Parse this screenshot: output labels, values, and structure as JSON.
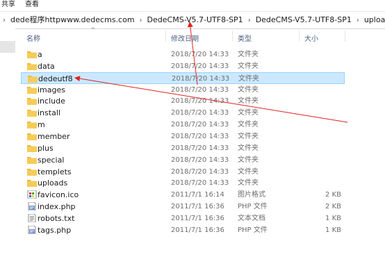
{
  "menu": {
    "share_label": "共享",
    "view_label": "查看"
  },
  "breadcrumb": {
    "items": [
      "dede程序httpwww.dedecms.com",
      "DedeCMS-V5.7-UTF8-SP1",
      "DedeCMS-V5.7-UTF8-SP1",
      "uploads"
    ],
    "separator": "›"
  },
  "columns": {
    "name": "名称",
    "date": "修改日期",
    "type": "类型",
    "size": "大小"
  },
  "files": [
    {
      "name": "a",
      "date": "2018/7/20 14:33",
      "type": "文件夹",
      "size": "",
      "icon": "folder-icon"
    },
    {
      "name": "data",
      "date": "2018/7/20 14:33",
      "type": "文件夹",
      "size": "",
      "icon": "folder-icon"
    },
    {
      "name": "dedeutf8",
      "date": "2018/7/20 14:33",
      "type": "文件夹",
      "size": "",
      "icon": "folder-icon",
      "selected": true
    },
    {
      "name": "images",
      "date": "2018/7/20 14:33",
      "type": "文件夹",
      "size": "",
      "icon": "folder-icon"
    },
    {
      "name": "include",
      "date": "2018/7/20 14:33",
      "type": "文件夹",
      "size": "",
      "icon": "folder-icon"
    },
    {
      "name": "install",
      "date": "2018/7/20 14:33",
      "type": "文件夹",
      "size": "",
      "icon": "folder-icon"
    },
    {
      "name": "m",
      "date": "2018/7/20 14:33",
      "type": "文件夹",
      "size": "",
      "icon": "folder-icon"
    },
    {
      "name": "member",
      "date": "2018/7/20 14:33",
      "type": "文件夹",
      "size": "",
      "icon": "folder-icon"
    },
    {
      "name": "plus",
      "date": "2018/7/20 14:33",
      "type": "文件夹",
      "size": "",
      "icon": "folder-icon"
    },
    {
      "name": "special",
      "date": "2018/7/20 14:33",
      "type": "文件夹",
      "size": "",
      "icon": "folder-icon"
    },
    {
      "name": "templets",
      "date": "2018/7/20 14:33",
      "type": "文件夹",
      "size": "",
      "icon": "folder-icon"
    },
    {
      "name": "uploads",
      "date": "2018/7/20 14:33",
      "type": "文件夹",
      "size": "",
      "icon": "folder-icon"
    },
    {
      "name": "favicon.ico",
      "date": "2011/7/1 16:14",
      "type": "图片格式",
      "size": "2 KB",
      "icon": "image-file-icon"
    },
    {
      "name": "index.php",
      "date": "2011/7/1 16:36",
      "type": "PHP 文件",
      "size": "2 KB",
      "icon": "php-file-icon"
    },
    {
      "name": "robots.txt",
      "date": "2011/7/1 16:36",
      "type": "文本文档",
      "size": "1 KB",
      "icon": "text-file-icon"
    },
    {
      "name": "tags.php",
      "date": "2011/7/1 16:36",
      "type": "PHP 文件",
      "size": "1 KB",
      "icon": "php-file-icon"
    }
  ],
  "colors": {
    "selection_bg": "#cce8ff",
    "selection_border": "#99d1ff",
    "folder": "#f5cc57",
    "annotation_arrow": "#e02020"
  }
}
